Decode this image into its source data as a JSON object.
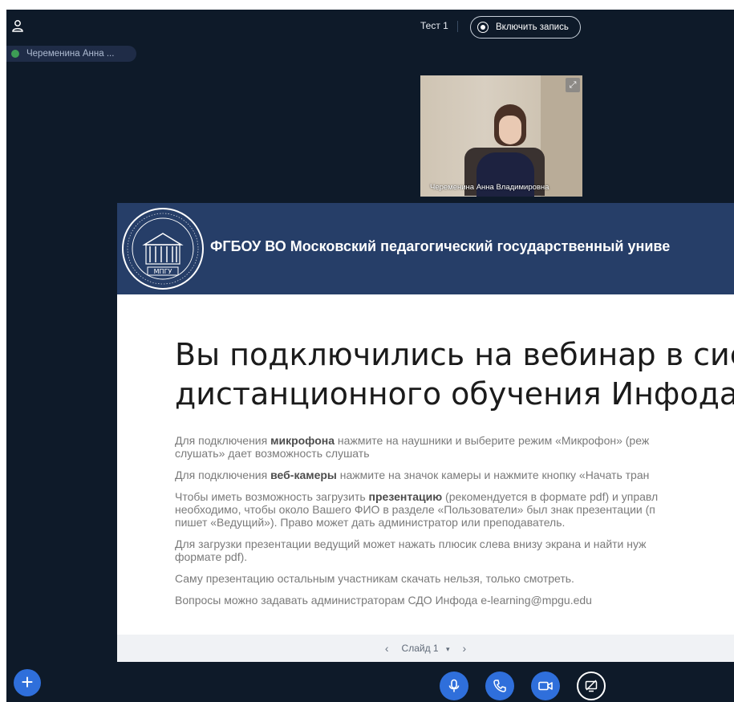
{
  "participants": {
    "items": [
      {
        "name": "Череменина Анна ..."
      }
    ]
  },
  "header": {
    "meeting_title": "Тест 1",
    "record_label": "Включить запись"
  },
  "webcam": {
    "name_label": "Череменина Анна Владимировна"
  },
  "slide": {
    "logo_text": "МПГУ",
    "banner_title": "ФГБОУ ВО Московский педагогический государственный униве",
    "heading_line1": "Вы подключились на вебинар в сис",
    "heading_line2": "дистанционного обучения Инфода",
    "paragraphs": {
      "p1_pre": "Для подключения ",
      "p1_bold": "микрофона",
      "p1_post": " нажмите на наушники и выберите режим «Микрофон» (реж",
      "p1_line2": "слушать» дает возможность слушать",
      "p2_pre": "Для подключения ",
      "p2_bold": "веб-камеры",
      "p2_post": " нажмите на значок камеры и нажмите кнопку «Начать тран",
      "p3_pre": "Чтобы иметь возможность загрузить ",
      "p3_bold": "презентацию",
      "p3_post": " (рекомендуется в формате pdf) и управл",
      "p3_line2": "необходимо, чтобы около Вашего ФИО в разделе «Пользователи» был знак презентации (п",
      "p3_line3": "пишет «Ведущий»). Право может дать администратор или преподаватель.",
      "p4_line1": "Для загрузки презентации ведущий может нажать плюсик слева внизу экрана и найти нуж",
      "p4_line2": "формате pdf).",
      "p5": "Саму презентацию остальным участникам скачать нельзя, только смотреть.",
      "p6": "Вопросы можно задавать администраторам СДО Инфода e-learning@mpgu.edu"
    },
    "nav": {
      "prev": "‹",
      "current": "Слайд 1",
      "dropdown": "▾",
      "next": "›"
    }
  },
  "controls": {
    "add_icon": "plus-icon",
    "mic_icon": "microphone-icon",
    "phone_icon": "phone-icon",
    "camera_icon": "video-camera-icon",
    "screen_icon": "screen-share-off-icon"
  },
  "colors": {
    "background": "#0e1a29",
    "accent": "#2f6fdb",
    "banner": "#263e68",
    "presence": "#3d9d55"
  }
}
